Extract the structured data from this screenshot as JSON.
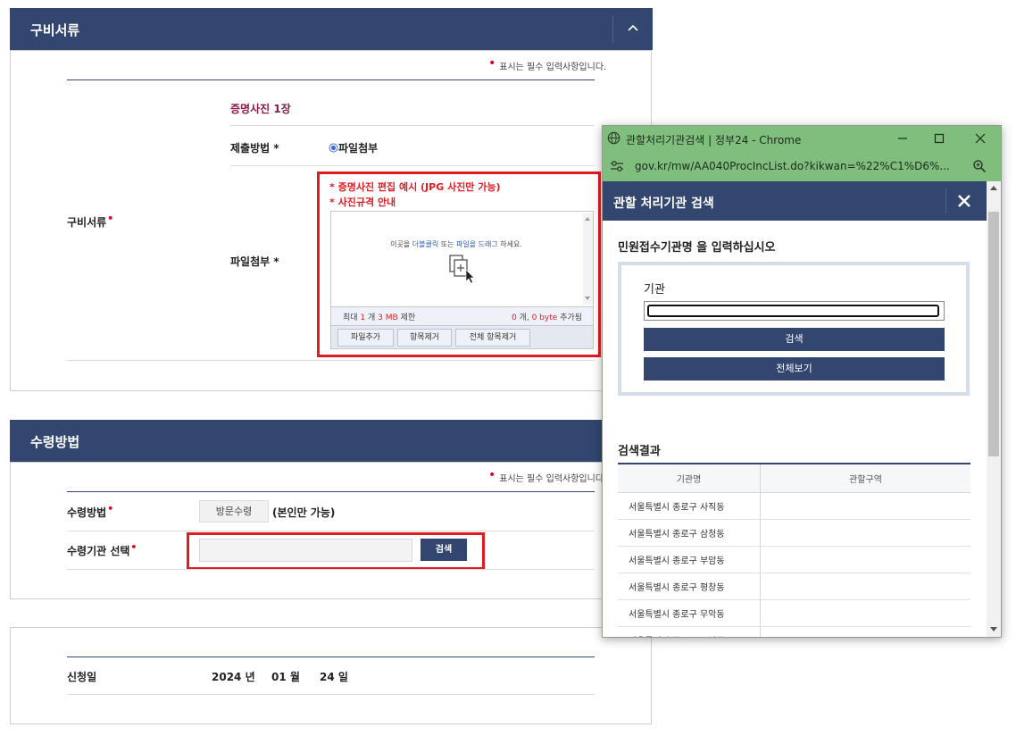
{
  "section1": {
    "title": "구비서류",
    "required_note": "표시는 필수 입력사항입니다.",
    "row_label": "구비서류",
    "photo_title": "증명사진 1장",
    "submit_method_label": "제출방법 *",
    "submit_method_value": "파일첨부",
    "file_attach_label": "파일첨부 *",
    "link_example": "* 증명사진 편집 예시 (JPG 사진만 가능)",
    "link_spec": "* 사진규격 안내",
    "drop_hint_pre": "이곳을 ",
    "drop_hint_dbl": "더블클릭",
    "drop_hint_mid": " 또는 ",
    "drop_hint_file": "파일을 드래그",
    "drop_hint_post": " 하세요.",
    "limit_pre": "최대 ",
    "limit_count": "1",
    "limit_mid": " 개 ",
    "limit_size": "3 MB",
    "limit_post": " 제한",
    "added_count": "0",
    "added_mid": " 개, ",
    "added_size": "0 byte",
    "added_post": " 추가됨",
    "btn_add": "파일추가",
    "btn_remove": "항목제거",
    "btn_remove_all": "전체 항목제거"
  },
  "section2": {
    "title": "수령방법",
    "required_note": "표시는 필수 입력사항입니다.",
    "receive_method_label": "수령방법",
    "receive_method_value": "방문수령",
    "receive_method_note": "(본인만 가능)",
    "office_label": "수령기관 선택",
    "search_button": "검색"
  },
  "section3": {
    "date_label": "신청일",
    "year": "2024",
    "year_unit": "년",
    "month": "01",
    "month_unit": "월",
    "day": "24",
    "day_unit": "일"
  },
  "popup": {
    "window_title": "관할처리기관검색 | 정부24 - Chrome",
    "url": "gov.kr/mw/AA040ProcIncList.do?kikwan=%22%C1%D6%...",
    "dialog_title": "관할 처리기관 검색",
    "instruction": "민원접수기관명 을 입력하십시오",
    "field_label": "기관",
    "field_value": "",
    "search_button": "검색",
    "view_all_button": "전체보기",
    "results_title": "검색결과",
    "col_name": "기관명",
    "col_area": "관할구역",
    "rows": [
      {
        "name": "서울특별시 종로구 사직동",
        "area": ""
      },
      {
        "name": "서울특별시 종로구 삼청동",
        "area": ""
      },
      {
        "name": "서울특별시 종로구 부암동",
        "area": ""
      },
      {
        "name": "서울특별시 종로구 평창동",
        "area": ""
      },
      {
        "name": "서울특별시 종로구 무악동",
        "area": ""
      },
      {
        "name": "서울특별시 종로구 교남동",
        "area": ""
      }
    ]
  },
  "colors": {
    "header_navy": "#33466f",
    "required_red": "#e21b23",
    "chrome_green": "#7fbe7c",
    "photo_title_maroon": "#8a1c4a"
  }
}
